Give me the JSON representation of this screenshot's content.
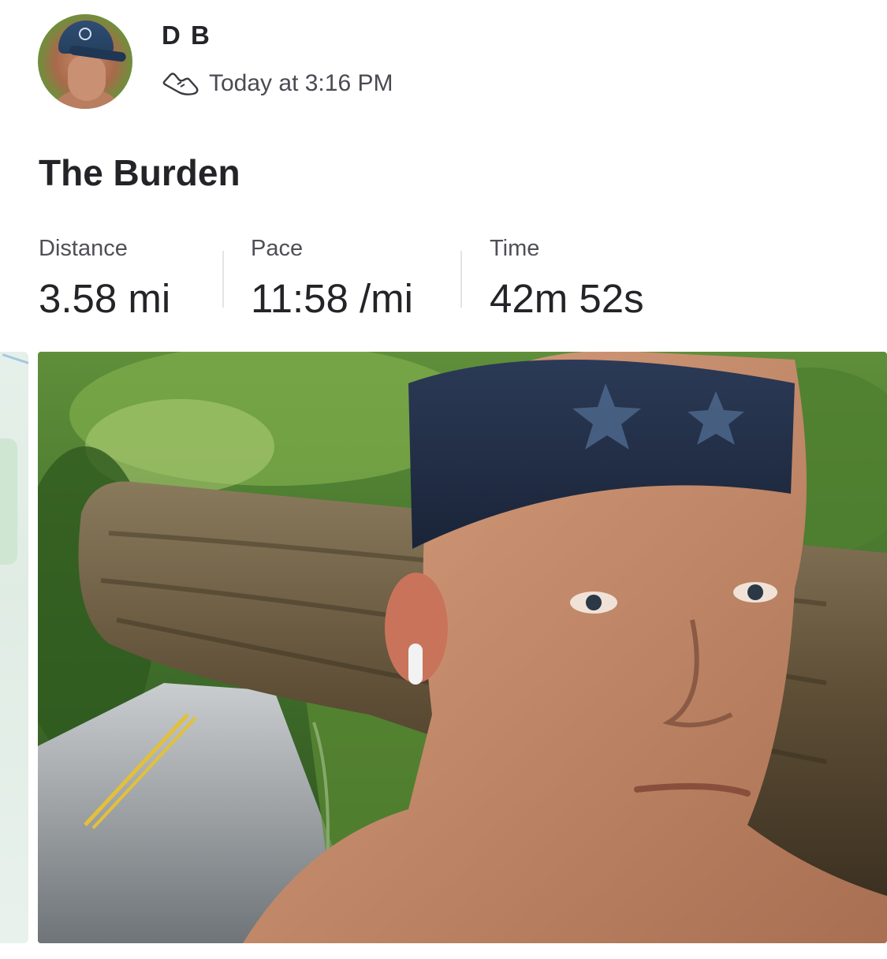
{
  "header": {
    "username": "D B",
    "timestamp": "Today at 3:16 PM",
    "activity_icon": "running-shoe-icon"
  },
  "activity": {
    "title": "The Burden"
  },
  "stats": [
    {
      "label": "Distance",
      "value": "3.58 mi"
    },
    {
      "label": "Pace",
      "value": "11:58 /mi"
    },
    {
      "label": "Time",
      "value": "42m 52s"
    }
  ],
  "colors": {
    "text_primary": "#242428",
    "text_secondary": "#4f4f57",
    "divider": "#e4e4e8",
    "background": "#ffffff"
  }
}
